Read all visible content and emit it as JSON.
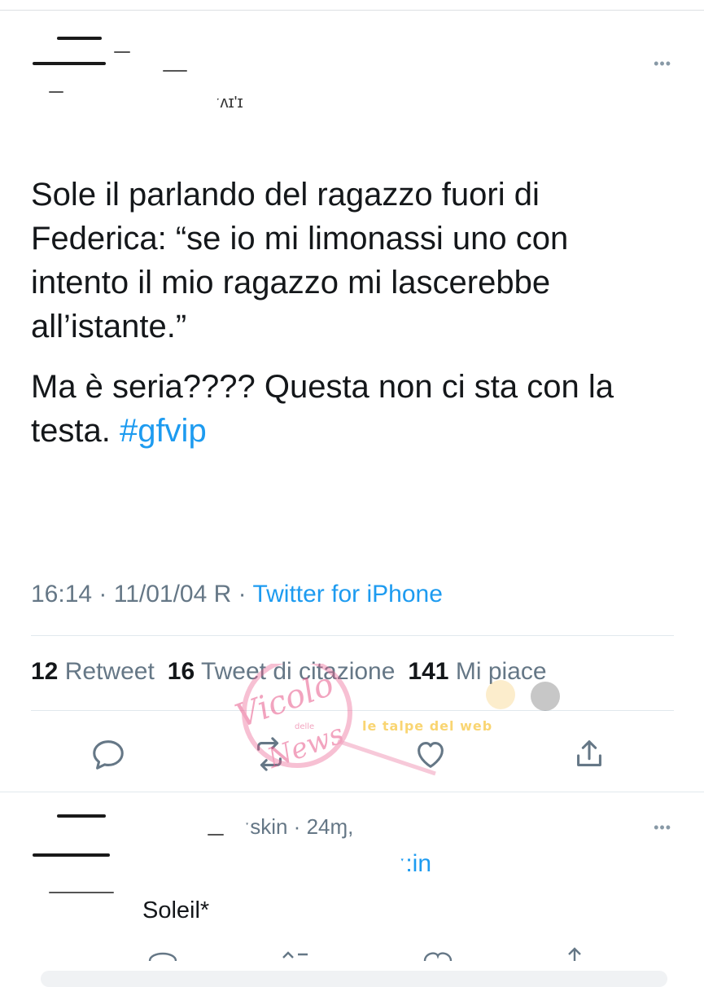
{
  "tweet": {
    "author_handle_fragment": "ˑʌɪ'ɪ",
    "text_paragraphs": [
      "Sole il parlando del ragazzo fuori di Federica: “se io mi limonassi uno con intento il mio ragazzo mi lascerebbe all’istante.”"
    ],
    "text_last_prefix": "Ma è seria???? Questa non ci sta con la testa. ",
    "hashtag": "#gfvip",
    "time": "16:14",
    "date": "11/01/04 R",
    "separator": " · ",
    "source": "Twitter for iPhone",
    "stats": {
      "retweets_count": "12",
      "retweets_label": "Retweet",
      "quotes_count": "16",
      "quotes_label": "Tweet di citazione",
      "likes_count": "141",
      "likes_label": "Mi piace"
    },
    "more_label": "•••"
  },
  "reply": {
    "handle_fragment": "ˑskin · 24ɱ,",
    "handle_fragment_2": "ˑ:in",
    "text": "Soleil*",
    "more_label": "•••"
  },
  "watermark": {
    "line1": "Vicolo",
    "line2": "delle",
    "line3": "News",
    "line4": "le talpe del web"
  },
  "colors": {
    "accent": "#1d9bf0",
    "secondary_text": "#657786",
    "primary_text": "#14171a",
    "divider": "#e1e8ed"
  },
  "icons": [
    "reply-icon",
    "retweet-icon",
    "like-icon",
    "share-icon",
    "more-icon"
  ]
}
